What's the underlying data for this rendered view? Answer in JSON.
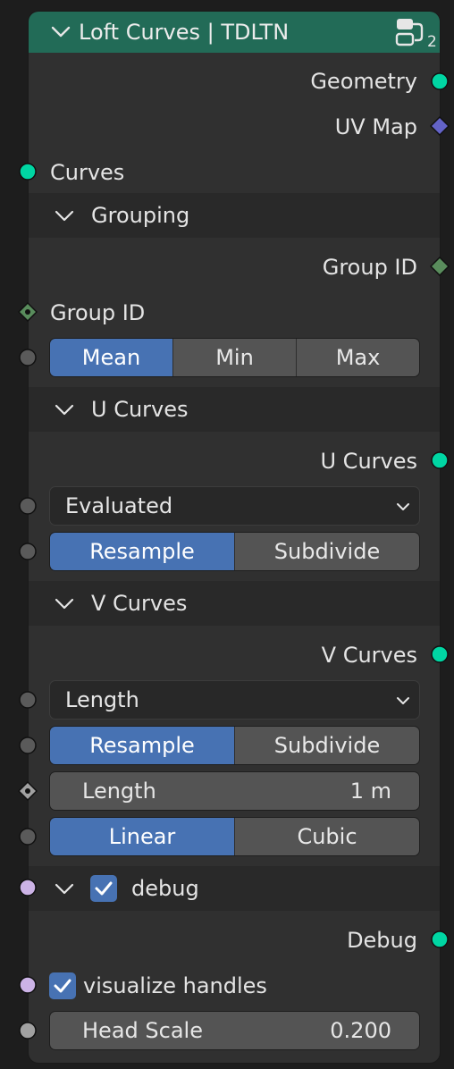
{
  "node": {
    "title": "Loft Curves | TDLTN",
    "user_count": "2",
    "colors": {
      "header": "#226b57",
      "body": "#303030",
      "accent": "#4772b3",
      "socket_geometry": "#00d6a3",
      "socket_vector": "#6363c7",
      "socket_int": "#598c5c",
      "socket_bool": "#ccb3e6",
      "socket_value": "#a1a1a1"
    }
  },
  "outputs": {
    "geometry": "Geometry",
    "uv_map": "UV Map"
  },
  "inputs": {
    "curves": "Curves"
  },
  "grouping": {
    "label": "Grouping",
    "output_group_id": "Group ID",
    "input_group_id": "Group ID",
    "mode_options": [
      "Mean",
      "Min",
      "Max"
    ],
    "mode_selected": "Mean"
  },
  "u_curves": {
    "label": "U Curves",
    "output": "U Curves",
    "dropdown_value": "Evaluated",
    "method_options": [
      "Resample",
      "Subdivide"
    ],
    "method_selected": "Resample"
  },
  "v_curves": {
    "label": "V Curves",
    "output": "V Curves",
    "dropdown_value": "Length",
    "method_options": [
      "Resample",
      "Subdivide"
    ],
    "method_selected": "Resample",
    "length_label": "Length",
    "length_value": "1 m",
    "interp_options": [
      "Linear",
      "Cubic"
    ],
    "interp_selected": "Linear"
  },
  "debug": {
    "label": "debug",
    "enabled": true,
    "output": "Debug",
    "visualize_handles_label": "visualize handles",
    "visualize_handles_checked": true,
    "head_scale_label": "Head Scale",
    "head_scale_value": "0.200"
  }
}
